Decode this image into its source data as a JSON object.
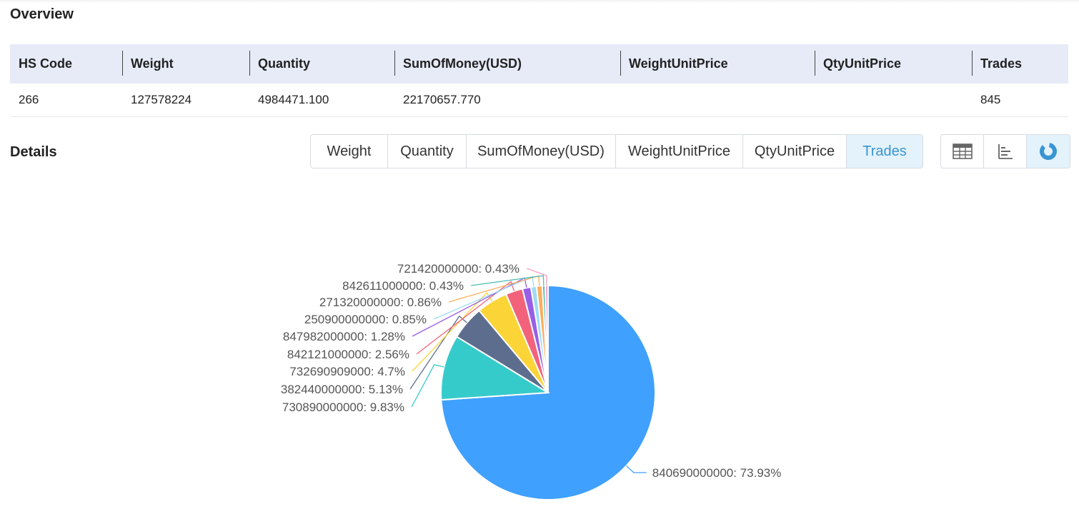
{
  "overview": {
    "title": "Overview",
    "headers": [
      "HS Code",
      "Weight",
      "Quantity",
      "SumOfMoney(USD)",
      "WeightUnitPrice",
      "QtyUnitPrice",
      "Trades"
    ],
    "row": [
      "266",
      "127578224",
      "4984471.100",
      "22170657.770",
      "",
      "",
      "845"
    ]
  },
  "details": {
    "title": "Details",
    "metric_tabs": [
      "Weight",
      "Quantity",
      "SumOfMoney(USD)",
      "WeightUnitPrice",
      "QtyUnitPrice",
      "Trades"
    ],
    "active_metric": "Trades",
    "view_buttons": [
      {
        "icon": "table-icon",
        "active": false
      },
      {
        "icon": "bar-chart-icon",
        "active": false
      },
      {
        "icon": "pie-chart-icon",
        "active": true
      }
    ]
  },
  "chart_data": {
    "type": "pie",
    "title": "",
    "categories": [
      "840690000000",
      "730890000000",
      "382440000000",
      "732690909000",
      "842121000000",
      "847982000000",
      "250900000000",
      "271320000000",
      "842611000000",
      "721420000000"
    ],
    "values": [
      73.93,
      9.83,
      5.13,
      4.7,
      2.56,
      1.28,
      0.85,
      0.86,
      0.43,
      0.43
    ],
    "labels": [
      "840690000000: 73.93%",
      "730890000000: 9.83%",
      "382440000000: 5.13%",
      "732690909000: 4.7%",
      "842121000000: 2.56%",
      "847982000000: 1.28%",
      "250900000000: 0.85%",
      "271320000000: 0.86%",
      "842611000000: 0.43%",
      "721420000000: 0.43%"
    ],
    "colors": [
      "#3fa0fd",
      "#36cbcb",
      "#5d6d8e",
      "#fbd437",
      "#f2637b",
      "#975fe5",
      "#9ddcf3",
      "#fbae5c",
      "#4cbcae",
      "#f99ec2"
    ]
  }
}
